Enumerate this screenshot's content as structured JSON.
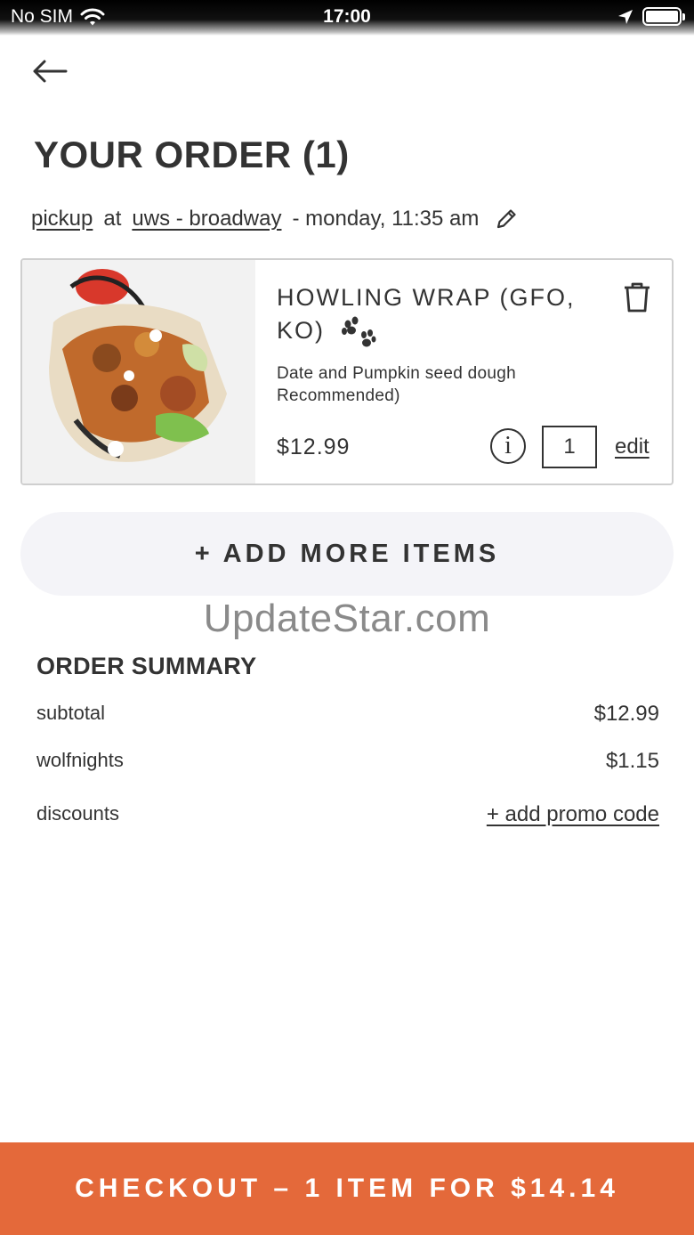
{
  "status_bar": {
    "carrier": "No SIM",
    "time": "17:00"
  },
  "header": {
    "title": "YOUR ORDER (1)"
  },
  "pickup": {
    "mode": "pickup",
    "at": "at",
    "location": "uws - broadway",
    "time": "- monday, 11:35 am"
  },
  "item": {
    "name": "HOWLING WRAP (GFO, KO)",
    "description": "Date and Pumpkin seed dough Recommended)",
    "price": "$12.99",
    "quantity": "1",
    "edit_label": "edit",
    "info_label": "i"
  },
  "add_items_label": "+ ADD MORE ITEMS",
  "watermark": "UpdateStar.com",
  "summary": {
    "title": "ORDER SUMMARY",
    "rows": [
      {
        "label": "subtotal",
        "value": "$12.99"
      },
      {
        "label": "wolfnights",
        "value": "$1.15"
      },
      {
        "label": "discounts",
        "value": "+ add promo code"
      }
    ]
  },
  "checkout_label": "CHECKOUT – 1 ITEM FOR $14.14",
  "colors": {
    "accent": "#e4693a",
    "text": "#333333",
    "add_button_bg": "#f4f4f8"
  }
}
